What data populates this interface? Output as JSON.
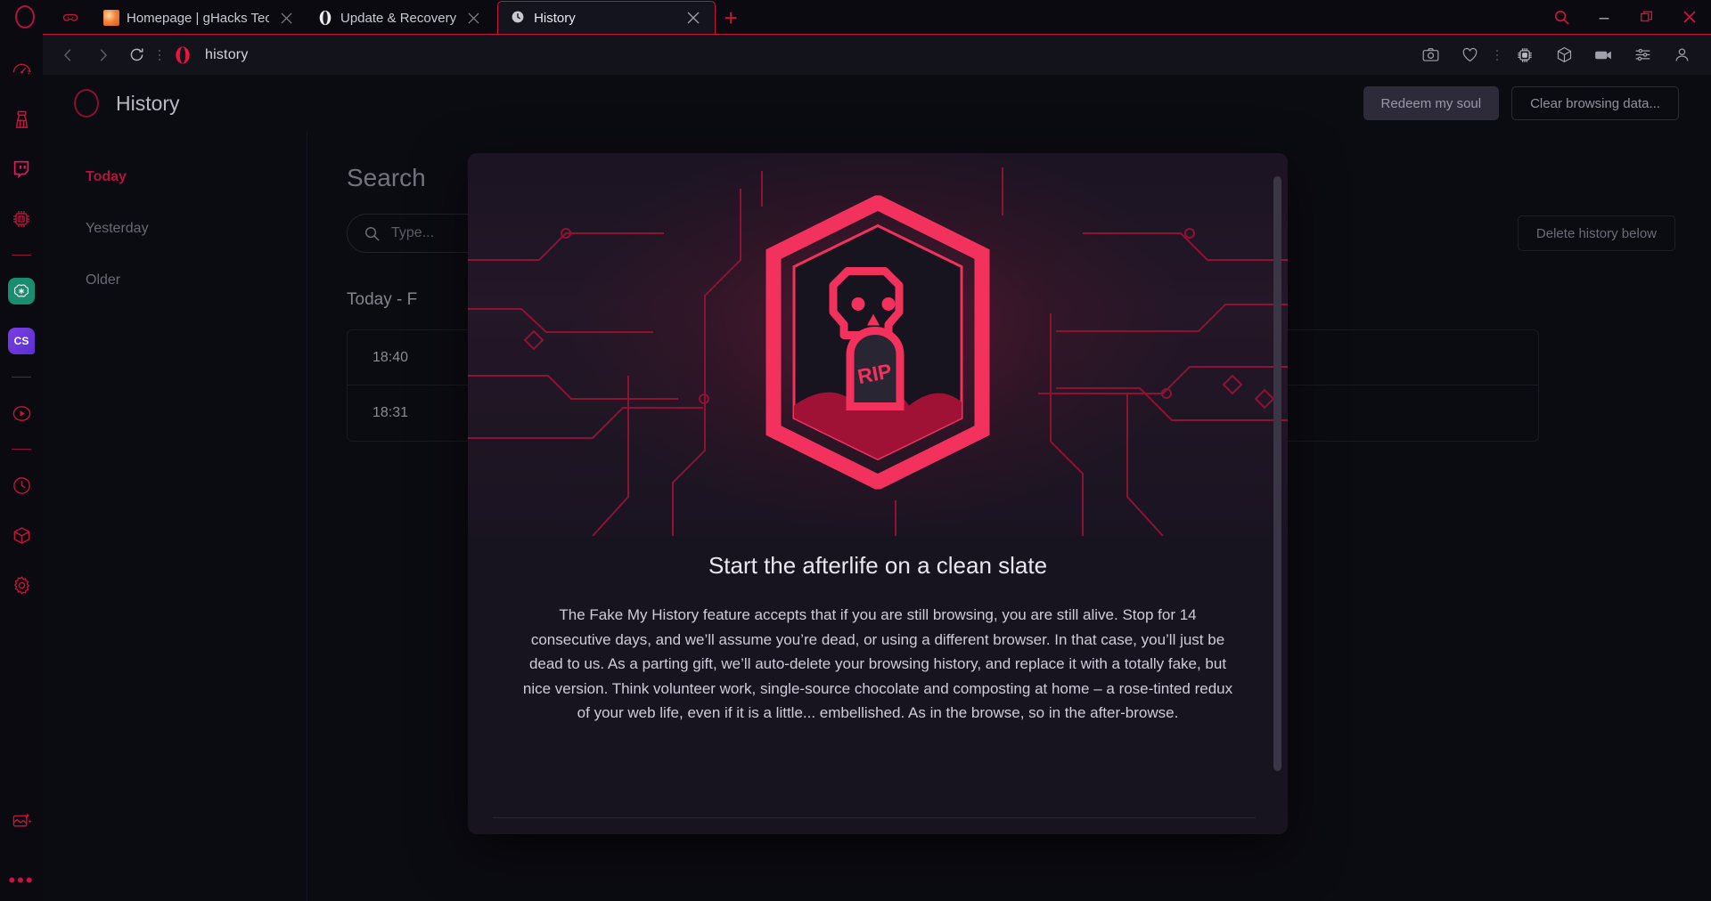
{
  "window": {
    "controls": [
      {
        "name": "search-icon",
        "glyph": "search"
      },
      {
        "name": "minimize-icon",
        "glyph": "minimize"
      },
      {
        "name": "maximize-icon",
        "glyph": "maximize"
      },
      {
        "name": "close-icon",
        "glyph": "close"
      }
    ],
    "accent": "#c8143c",
    "background": "#0a0a10"
  },
  "tabs": [
    {
      "title": "Homepage | gHacks Techno",
      "icon": "ghacks-favicon",
      "active": false
    },
    {
      "title": "Update & Recovery",
      "icon": "opera-favicon",
      "active": false
    },
    {
      "title": "History",
      "icon": "history-favicon",
      "active": true
    }
  ],
  "newtab_label": "+",
  "toolbar": {
    "back": "‹",
    "forward": "›",
    "reload": "reload-icon",
    "address_value": "history",
    "right_icons": [
      "snapshot-icon",
      "heart-icon",
      "ai-chip-icon",
      "cube-icon",
      "player-icon",
      "sliders-icon",
      "profile-icon"
    ]
  },
  "sidebar": {
    "items": [
      {
        "name": "speed-dial-icon",
        "label": "Speed"
      },
      {
        "name": "cleaner-icon",
        "label": "Cleaner"
      },
      {
        "name": "twitch-icon",
        "label": "Twitch"
      },
      {
        "name": "ai-chip-icon",
        "label": "Aria"
      },
      {
        "name": "chatgpt-icon",
        "label": "ChatGPT"
      },
      {
        "name": "cs-icon",
        "label": "CS"
      },
      {
        "name": "player-icon",
        "label": "Player"
      },
      {
        "name": "history-icon",
        "label": "History"
      },
      {
        "name": "cube-icon",
        "label": "Extensions"
      },
      {
        "name": "gear-icon",
        "label": "Settings"
      }
    ],
    "bottom": [
      {
        "name": "image-sparkle-icon",
        "label": "Wallpapers"
      },
      {
        "name": "more-dots-icon",
        "label": "•••"
      }
    ]
  },
  "page": {
    "title": "History",
    "buttons": {
      "redeem": "Redeem my soul",
      "clear": "Clear browsing data..."
    },
    "nav": [
      {
        "label": "Today",
        "active": true
      },
      {
        "label": "Yesterday",
        "active": false
      },
      {
        "label": "Older",
        "active": false
      }
    ],
    "search": {
      "heading": "Search",
      "placeholder": "Type...",
      "value": ""
    },
    "delete_below": "Delete history below",
    "day_heading": "Today - F",
    "entries": [
      {
        "time": "18:40",
        "title": ""
      },
      {
        "time": "18:31",
        "title": ""
      }
    ]
  },
  "modal": {
    "art": {
      "badge": "skull-rip-badge",
      "tombstone_text": "RIP",
      "accent": "#f2325c",
      "mound": "#a01235"
    },
    "heading": "Start the afterlife on a clean slate",
    "body": "The Fake My History feature accepts that if you are still browsing, you are still alive. Stop for 14 consecutive days, and we’ll assume you’re dead, or using a different browser. In that case, you’ll just be dead to us. As a parting gift, we’ll auto-delete your browsing history, and replace it with a totally fake, but nice version. Think volunteer work, single-source chocolate and composting at home – a rose-tinted redux of your web life, even if it is a little... embellished. As in the browse, so in the after-browse."
  }
}
